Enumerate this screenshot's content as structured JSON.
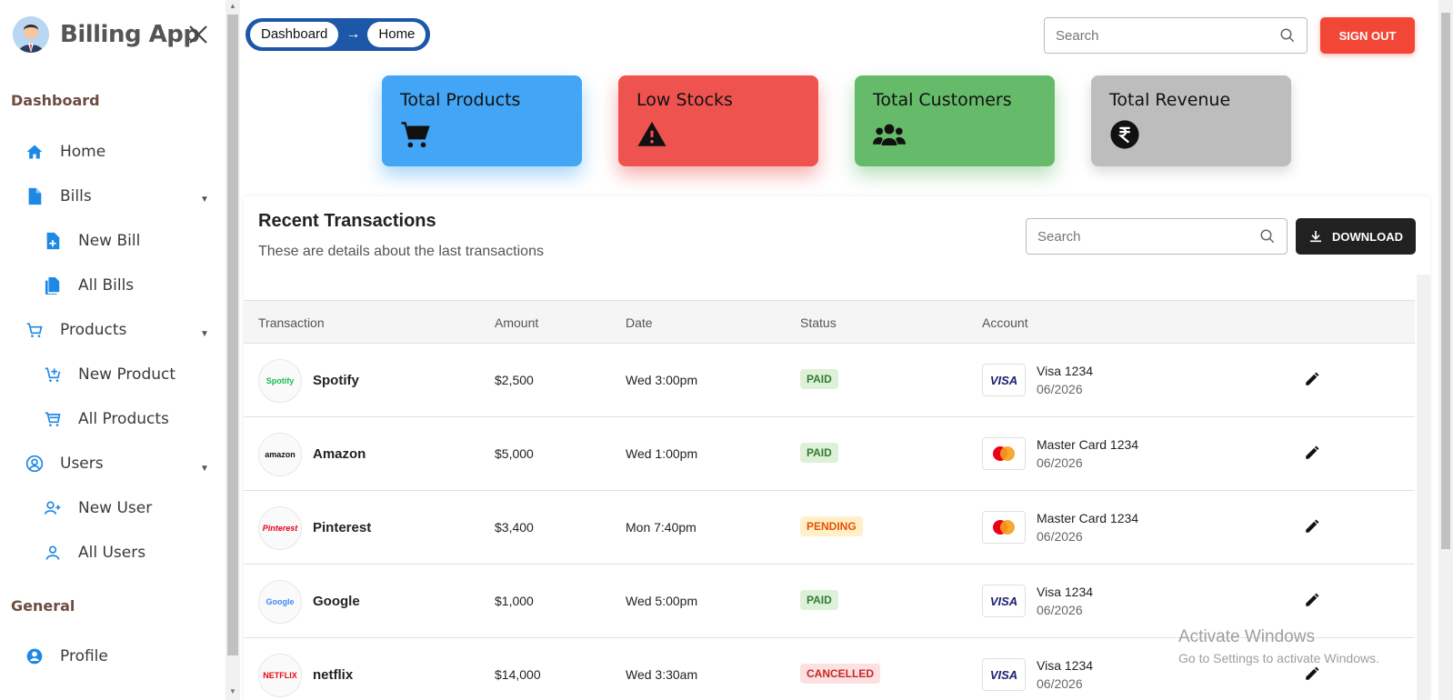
{
  "app": {
    "title": "Billing App"
  },
  "sidebar": {
    "sections": [
      {
        "label": "Dashboard"
      },
      {
        "label": "General"
      }
    ],
    "items": [
      {
        "label": "Home"
      },
      {
        "label": "Bills"
      },
      {
        "label": "New Bill"
      },
      {
        "label": "All Bills"
      },
      {
        "label": "Products"
      },
      {
        "label": "New Product"
      },
      {
        "label": "All Products"
      },
      {
        "label": "Users"
      },
      {
        "label": "New User"
      },
      {
        "label": "All Users"
      },
      {
        "label": "Profile"
      }
    ]
  },
  "header": {
    "breadcrumb": [
      "Dashboard",
      "Home"
    ],
    "search_placeholder": "Search",
    "signout_label": "SIGN OUT"
  },
  "stats": [
    {
      "title": "Total Products",
      "icon": "cart-icon"
    },
    {
      "title": "Low Stocks",
      "icon": "warning-icon"
    },
    {
      "title": "Total Customers",
      "icon": "users-icon"
    },
    {
      "title": "Total Revenue",
      "icon": "rupee-icon"
    }
  ],
  "transactions": {
    "title": "Recent Transactions",
    "subtitle": "These are details about the last transactions",
    "search_placeholder": "Search",
    "download_label": "DOWNLOAD",
    "columns": [
      "Transaction",
      "Amount",
      "Date",
      "Status",
      "Account"
    ],
    "rows": [
      {
        "logo": "Spotify",
        "name": "Spotify",
        "amount": "$2,500",
        "date": "Wed 3:00pm",
        "status": "PAID",
        "card": "visa",
        "account": "Visa 1234",
        "expiry": "06/2026"
      },
      {
        "logo": "amazon",
        "name": "Amazon",
        "amount": "$5,000",
        "date": "Wed 1:00pm",
        "status": "PAID",
        "card": "mastercard",
        "account": "Master Card 1234",
        "expiry": "06/2026"
      },
      {
        "logo": "Pinterest",
        "name": "Pinterest",
        "amount": "$3,400",
        "date": "Mon 7:40pm",
        "status": "PENDING",
        "card": "mastercard",
        "account": "Master Card 1234",
        "expiry": "06/2026"
      },
      {
        "logo": "Google",
        "name": "Google",
        "amount": "$1,000",
        "date": "Wed 5:00pm",
        "status": "PAID",
        "card": "visa",
        "account": "Visa 1234",
        "expiry": "06/2026"
      },
      {
        "logo": "NETFLIX",
        "name": "netflix",
        "amount": "$14,000",
        "date": "Wed 3:30am",
        "status": "CANCELLED",
        "card": "visa",
        "account": "Visa 1234",
        "expiry": "06/2026"
      }
    ]
  },
  "watermark": {
    "line1": "Activate Windows",
    "line2": "Go to Settings to activate Windows."
  },
  "colors": {
    "accent": "#1c57a8",
    "signout": "#f24636",
    "products": "#42a5f5",
    "stocks": "#ef5350",
    "customers": "#66bb6a",
    "revenue": "#bdbdbd"
  }
}
